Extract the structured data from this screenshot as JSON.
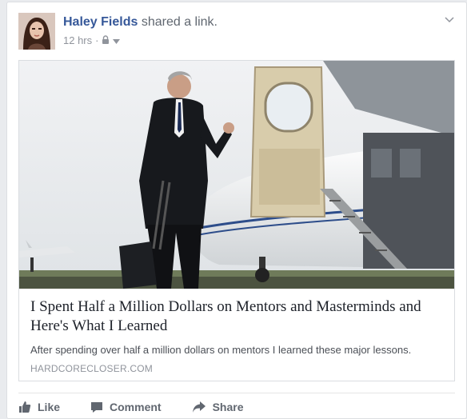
{
  "post": {
    "author": "Haley Fields",
    "action": "shared a link.",
    "time": "12 hrs",
    "separator": "·",
    "privacy_icon": "lock-icon"
  },
  "attachment": {
    "image_icon": "businessman-boarding-jet-image",
    "title": "I Spent Half a Million Dollars on Mentors and Masterminds and Here's What I Learned",
    "description": "After spending over half a million dollars on mentors I learned these major lessons.",
    "domain": "HARDCORECLOSER.COM"
  },
  "actions": [
    {
      "label": "Like",
      "icon": "thumbs-up-icon"
    },
    {
      "label": "Comment",
      "icon": "comment-icon"
    },
    {
      "label": "Share",
      "icon": "share-arrow-icon"
    }
  ],
  "colors": {
    "link": "#365899",
    "meta": "#90949c",
    "action": "#616770"
  }
}
